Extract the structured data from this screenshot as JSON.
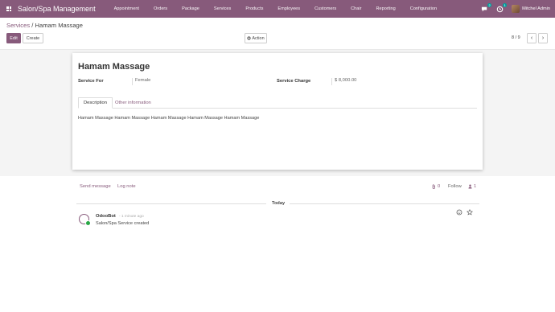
{
  "nav": {
    "brand": "Salon/Spa Management",
    "menu": [
      "Appointment",
      "Orders",
      "Package",
      "Services",
      "Products",
      "Employees",
      "Customers",
      "Chair",
      "Reporting",
      "Configuration"
    ],
    "chat_badge": "2",
    "activity_badge": "1",
    "user_name": "Mitchel Admin"
  },
  "breadcrumb": {
    "parent": "Services",
    "separator": "/",
    "current": "Hamam Massage"
  },
  "toolbar": {
    "edit_label": "Edit",
    "create_label": "Create",
    "action_label": "Action",
    "pager": "8 / 9",
    "prev": "‹",
    "next": "›"
  },
  "form": {
    "title": "Hamam Massage",
    "service_for_label": "Service For",
    "service_for_value": "Female",
    "service_charge_label": "Service Charge",
    "service_charge_value": "$ 8,000.00",
    "tabs": [
      "Description",
      "Other information"
    ],
    "description": "Hamam Massage Hamam Massage Hamam Massage Hamam Massage Hamam Massage"
  },
  "chatter": {
    "send_message": "Send message",
    "log_note": "Log note",
    "attachments_count": "0",
    "follow": "Follow",
    "followers_count": "1",
    "date_separator": "Today",
    "message": {
      "author": "OdooBot",
      "time": "- 1 minute ago",
      "body": "Salon/Spa Service created"
    }
  },
  "colors": {
    "brand": "#875a7b",
    "form_bg": "#f4f4f4"
  }
}
